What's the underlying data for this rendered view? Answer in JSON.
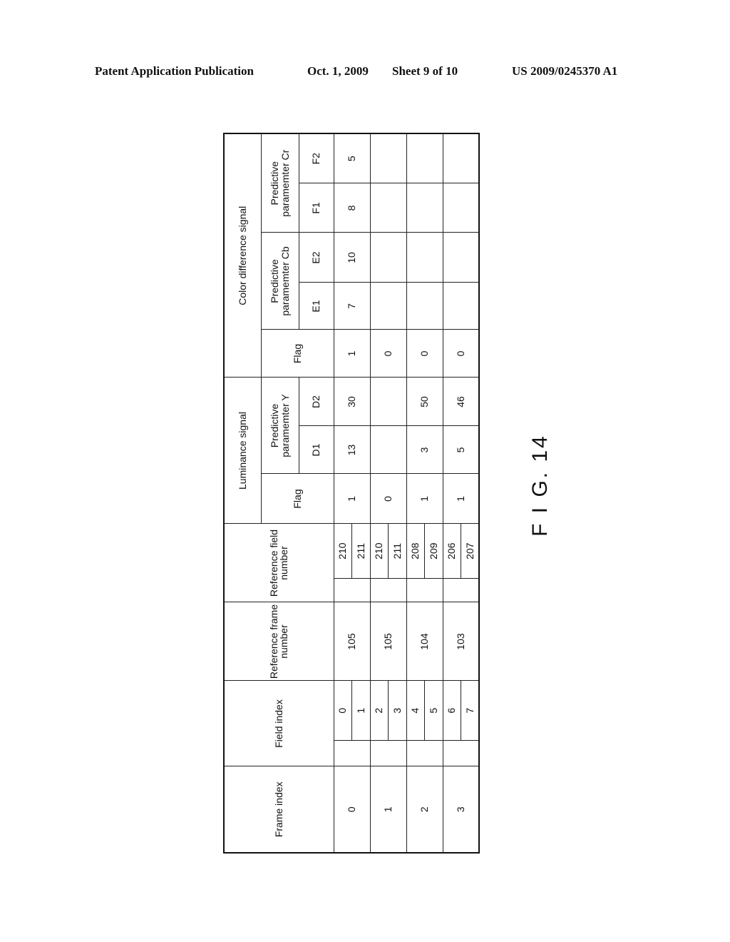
{
  "header": {
    "publication": "Patent Application Publication",
    "date": "Oct. 1, 2009",
    "sheet": "Sheet 9 of 10",
    "number": "US 2009/0245370 A1"
  },
  "figure_label": "F I G. 14",
  "table": {
    "headers": {
      "frame_index": "Frame index",
      "field_index": "Field index",
      "ref_frame": "Reference frame number",
      "ref_field": "Reference field number",
      "luminance": "Luminance signal",
      "color_diff": "Color difference signal",
      "flag": "Flag",
      "pred_y": "Predictive paramemter Y",
      "pred_cb": "Predictive paramemter Cb",
      "pred_cr": "Predictive paramemter Cr",
      "d1": "D1",
      "d2": "D2",
      "e1": "E1",
      "e2": "E2",
      "f1": "F1",
      "f2": "F2"
    },
    "rows": [
      {
        "frame": "0",
        "fields": [
          "0",
          "1"
        ],
        "ref_frame": "105",
        "ref_fields": [
          "210",
          "211"
        ],
        "lum_flag": "1",
        "d1": "13",
        "d2": "30",
        "col_flag": "1",
        "e1": "7",
        "e2": "10",
        "f1": "8",
        "f2": "5"
      },
      {
        "frame": "1",
        "fields": [
          "2",
          "3"
        ],
        "ref_frame": "105",
        "ref_fields": [
          "210",
          "211"
        ],
        "lum_flag": "0",
        "d1": "",
        "d2": "",
        "col_flag": "0",
        "e1": "",
        "e2": "",
        "f1": "",
        "f2": ""
      },
      {
        "frame": "2",
        "fields": [
          "4",
          "5"
        ],
        "ref_frame": "104",
        "ref_fields": [
          "208",
          "209"
        ],
        "lum_flag": "1",
        "d1": "3",
        "d2": "50",
        "col_flag": "0",
        "e1": "",
        "e2": "",
        "f1": "",
        "f2": ""
      },
      {
        "frame": "3",
        "fields": [
          "6",
          "7"
        ],
        "ref_frame": "103",
        "ref_fields": [
          "206",
          "207"
        ],
        "lum_flag": "1",
        "d1": "5",
        "d2": "46",
        "col_flag": "0",
        "e1": "",
        "e2": "",
        "f1": "",
        "f2": ""
      }
    ]
  }
}
